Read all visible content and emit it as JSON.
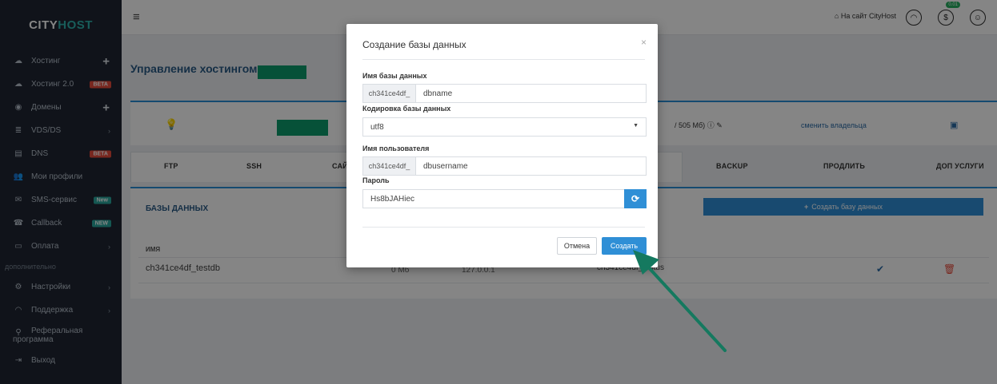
{
  "brand": {
    "part1": "CITY",
    "part2": "HOST"
  },
  "sidebar": {
    "items": [
      {
        "label": "Хостинг",
        "icon": "cloud-icon"
      },
      {
        "label": "Хостинг 2.0",
        "icon": "cloud-outline-icon",
        "badge": "BETA"
      },
      {
        "label": "Домены",
        "icon": "globe-icon"
      },
      {
        "label": "VDS/DS",
        "icon": "server-icon"
      },
      {
        "label": "DNS",
        "icon": "dns-icon",
        "badge": "BETA"
      },
      {
        "label": "Мои профили",
        "icon": "users-icon"
      },
      {
        "label": "SMS-сервис",
        "icon": "mail-icon",
        "badge": "New"
      },
      {
        "label": "Callback",
        "icon": "phone-icon",
        "badge": "NEW"
      },
      {
        "label": "Оплата",
        "icon": "card-icon"
      }
    ],
    "section_label": "дополнительно",
    "extra_items": [
      {
        "label": "Настройки",
        "icon": "gear-icon"
      },
      {
        "label": "Поддержка",
        "icon": "headset-icon"
      },
      {
        "label_line1": "Реферальная",
        "label_line2": "программа",
        "icon": "referral-icon"
      },
      {
        "label": "Выход",
        "icon": "exit-icon"
      }
    ]
  },
  "topbar": {
    "site_link": "На сайт CityHost",
    "balance_badge": "0.01"
  },
  "main": {
    "page_title": "Управление хостингом",
    "disk_usage": "/ 505 Мб)",
    "change_owner": "сменить владельца",
    "tabs": [
      "FTP",
      "SSH",
      "САЙ",
      "BACKUP",
      "ПРОДЛИТЬ",
      "ДОП УСЛУГИ"
    ],
    "db_section_title": "БАЗЫ ДАННЫХ",
    "create_db_button": "Создать базу данных",
    "table": {
      "col_name": "ИМЯ",
      "rows": [
        {
          "name": "ch341ce4df_testdb",
          "size": "0 Мб",
          "host": "127.0.0.1",
          "user": "ch341ce4df_testus"
        }
      ]
    }
  },
  "modal": {
    "title": "Создание базы данных",
    "db_name_label": "Имя базы данных",
    "db_prefix": "ch341ce4df_",
    "db_name_value": "dbname",
    "encoding_label": "Кодировка базы данных",
    "encoding_value": "utf8",
    "username_label": "Имя пользователя",
    "user_prefix": "ch341ce4df_",
    "username_value": "dbusername",
    "password_label": "Пароль",
    "password_value": "Hs8bJAHiec",
    "cancel_label": "Отмена",
    "create_label": "Создать"
  },
  "colors": {
    "sidebar_bg": "#1f2633",
    "accent_blue": "#2f8fd6",
    "annotation_arrow": "#15795f",
    "masked_block": "#0d9b6b"
  }
}
